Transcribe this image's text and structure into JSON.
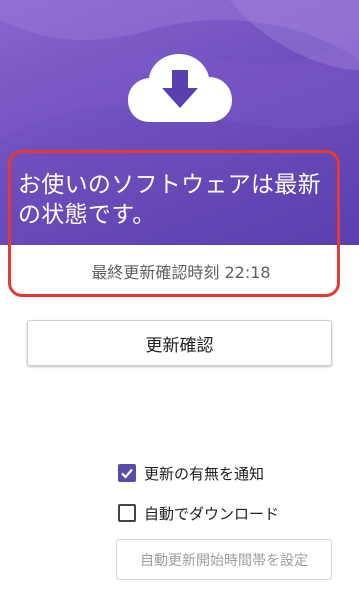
{
  "status": {
    "title": "お使いのソフトウェアは最新の状態です。",
    "last_checked": "最終更新確認時刻 22:18"
  },
  "icons": {
    "cloud": "cloud-download-icon",
    "check": "checkmark-icon"
  },
  "actions": {
    "check_now_label": "更新確認",
    "schedule_label": "自動更新開始時間帯を設定"
  },
  "options": {
    "notify": {
      "label": "更新の有無を通知",
      "checked": true
    },
    "auto_download": {
      "label": "自動でダウンロード",
      "checked": false
    }
  },
  "colors": {
    "header": "#6f4fbd",
    "accent": "#5c4aa8",
    "highlight": "#e53935"
  }
}
